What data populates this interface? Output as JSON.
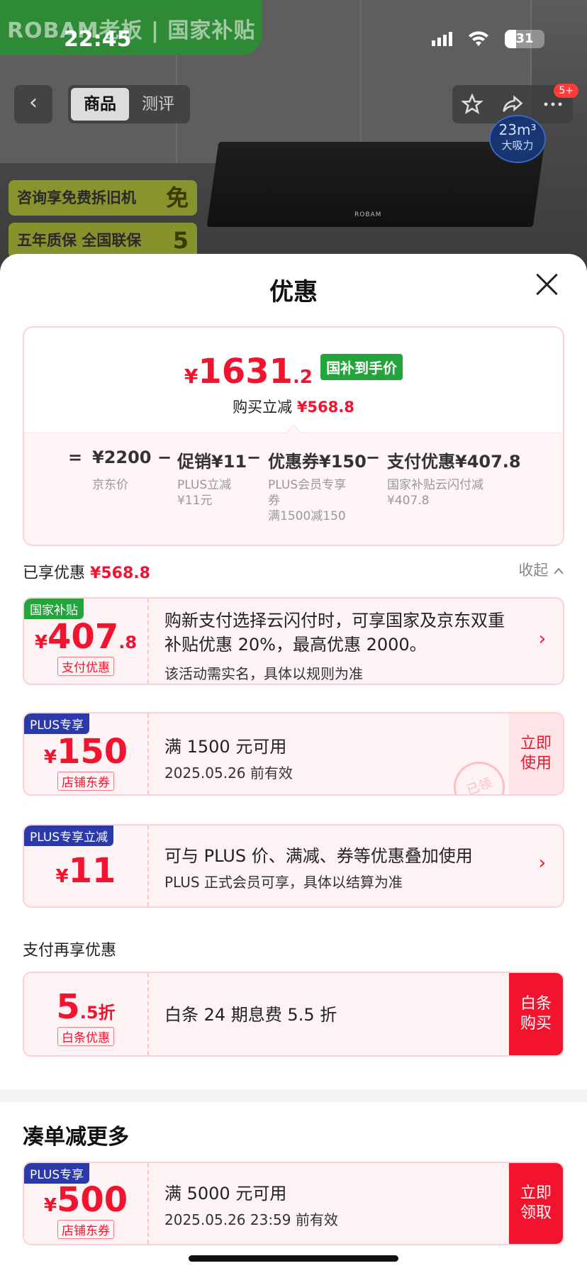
{
  "status_bar": {
    "time": "22:45",
    "battery": "31"
  },
  "hero": {
    "brand_banner": "ROBAM老板 | 国家补贴",
    "back_label": "‹",
    "tabs": [
      {
        "label": "商品",
        "active": true
      },
      {
        "label": "测评",
        "active": false
      }
    ],
    "badge": "5+",
    "suction_value": "23m³",
    "suction_label": "大吸力",
    "promo_tags": [
      {
        "text": "咨询享免费拆旧机",
        "mark": "免"
      },
      {
        "text": "五年质保 全国联保",
        "mark": "5"
      }
    ],
    "hood_logo": "ROBAM",
    "icons": [
      "star-icon",
      "share-icon",
      "more-icon"
    ]
  },
  "sheet": {
    "title": "优惠",
    "final_price": {
      "currency": "¥",
      "integer": "1631",
      "decimal": ".2",
      "tag": "国补到手价"
    },
    "instant_cut": {
      "label": "购买立减",
      "amount": "¥568.8"
    },
    "breakdown": [
      {
        "op": "=",
        "value": "¥2200",
        "note": "京东价"
      },
      {
        "op": "−",
        "value": "促销¥11",
        "note": "PLUS立减\n¥11元"
      },
      {
        "op": "−",
        "value": "优惠券¥150",
        "note": "PLUS会员专享\n券\n满1500减150"
      },
      {
        "op": "−",
        "value": "支付优惠¥407.8",
        "note": "国家补贴云闪付减\n¥407.8"
      }
    ],
    "enjoyed": {
      "label": "已享优惠",
      "amount": "¥568.8",
      "collapse": "收起"
    },
    "coupons": [
      {
        "ribbon": "国家补贴",
        "ribbon_color": "green",
        "currency": "¥",
        "integer": "407",
        "decimal": ".8",
        "tag": "支付优惠",
        "title": "购新支付选择云闪付时，可享国家及京东双重补贴优惠 20%，最高优惠 2000。",
        "subtitle": "该活动需实名，具体以规则为准",
        "chevron": "›"
      },
      {
        "ribbon": "PLUS专享",
        "ribbon_color": "blue",
        "currency": "¥",
        "integer": "150",
        "decimal": "",
        "tag": "店铺东券",
        "title": "满 1500 元可用",
        "subtitle": "2025.05.26 前有效",
        "action": "立即\n使用",
        "stamp": "已领"
      },
      {
        "ribbon": "PLUS专享立减",
        "ribbon_color": "blue",
        "currency": "¥",
        "integer": "11",
        "decimal": "",
        "tag": "",
        "title": "可与 PLUS 价、满减、券等优惠叠加使用",
        "subtitle": "PLUS 正式会员可享，具体以结算为准",
        "chevron": "›"
      }
    ],
    "pay_section_label": "支付再享优惠",
    "pay_offer": {
      "integer": "5",
      "decimal": ".5折",
      "tag": "白条优惠",
      "title": "白条 24 期息费 5.5 折",
      "action": "白条\n购买"
    },
    "more_title": "凑单减更多",
    "more_coupon": {
      "ribbon": "PLUS专享",
      "currency": "¥",
      "integer": "500",
      "tag": "店铺东券",
      "title": "满 5000 元可用",
      "subtitle": "2025.05.26 23:59 前有效",
      "action": "立即\n领取"
    }
  }
}
